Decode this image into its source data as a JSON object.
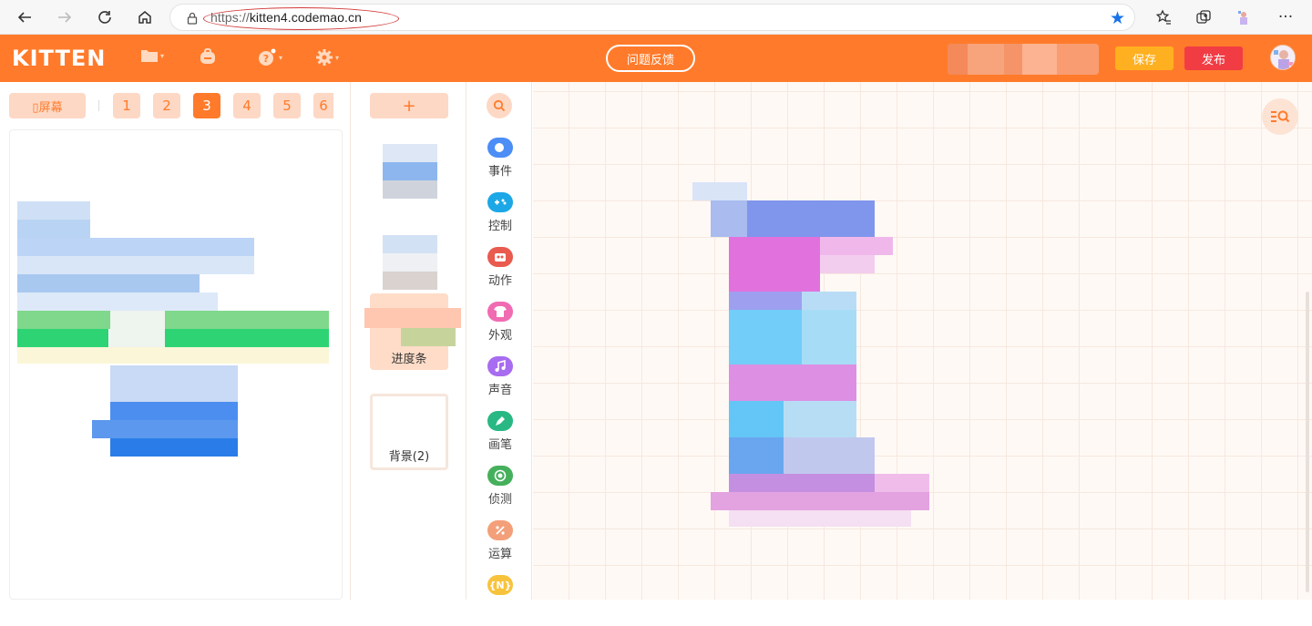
{
  "browser": {
    "url_protocol": "https://",
    "url_host": "kitten4.codemao.cn"
  },
  "header": {
    "logo": "KITTEN",
    "feedback_label": "问题反馈",
    "save_label": "保存",
    "publish_label": "发布"
  },
  "screens": {
    "label": "▯屏幕",
    "tabs": [
      "1",
      "2",
      "3",
      "4",
      "5",
      "6"
    ],
    "active_index": 2
  },
  "actors": {
    "add_label": "+",
    "items": [
      {
        "name": ""
      },
      {
        "name": ""
      },
      {
        "name": "进度条",
        "selected": true
      },
      {
        "name": "背景(2)"
      }
    ]
  },
  "categories": [
    {
      "label": "事件",
      "icon": "toggle-icon",
      "color": "#4c8df6"
    },
    {
      "label": "控制",
      "icon": "gamepad-icon",
      "color": "#1ca7e6"
    },
    {
      "label": "动作",
      "icon": "robot-icon",
      "color": "#e95a4f"
    },
    {
      "label": "外观",
      "icon": "shirt-icon",
      "color": "#f06bb2"
    },
    {
      "label": "声音",
      "icon": "music-icon",
      "color": "#a86cf0"
    },
    {
      "label": "画笔",
      "icon": "pen-icon",
      "color": "#29b883"
    },
    {
      "label": "侦测",
      "icon": "target-icon",
      "color": "#45b05b"
    },
    {
      "label": "运算",
      "icon": "math-icon",
      "color": "#f3a07a"
    },
    {
      "label": "",
      "icon": "variable-icon",
      "color": "#f8c33c",
      "glyph": "{N}"
    }
  ]
}
